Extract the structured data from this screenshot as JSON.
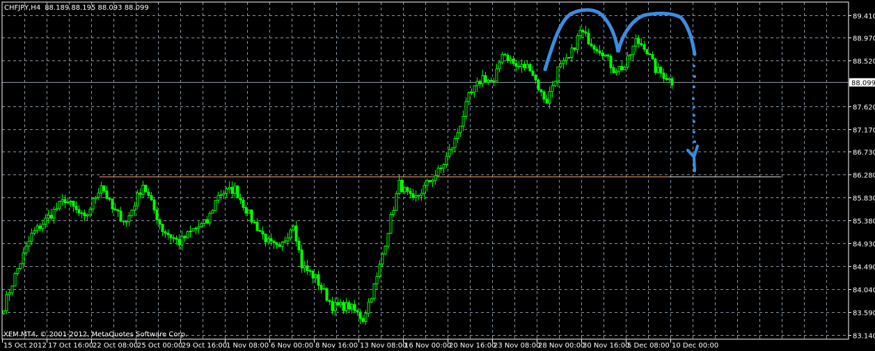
{
  "header": {
    "symbol": "CHFJPY,H4",
    "ohlc": "88.189 88.195 88.093 88.099"
  },
  "footer": {
    "copyright": "XEM MT4, © 2001-2012, MetaQuotes Software Corp."
  },
  "colors": {
    "background": "#000000",
    "candle": "#00ff00",
    "grid": "#8a9aa8",
    "price_line": "#8a9aa8",
    "level_line": "#f0a060",
    "drawing": "#3a8ee0",
    "text": "#ffffff"
  },
  "chart_data": {
    "type": "candlestick",
    "title": "CHFJPY,H4",
    "timeframe": "H4",
    "current_price": "88.099",
    "ylim": [
      83.14,
      89.6
    ],
    "y_ticks": [
      "89.410",
      "88.970",
      "88.520",
      "87.620",
      "87.170",
      "86.730",
      "86.280",
      "85.830",
      "85.380",
      "84.930",
      "84.490",
      "84.040",
      "83.590",
      "83.140"
    ],
    "y_tick_values": [
      89.41,
      88.97,
      88.52,
      87.62,
      87.17,
      86.73,
      86.28,
      85.83,
      85.38,
      84.93,
      84.49,
      84.04,
      83.59,
      83.14
    ],
    "x_ticks": [
      "15 Oct 2012",
      "17 Oct 16:00",
      "22 Oct 08:00",
      "25 Oct 00:00",
      "29 Oct 16:00",
      "1 Nov 08:00",
      "6 Nov 00:00",
      "8 Nov 16:00",
      "13 Nov 08:00",
      "16 Nov 00:00",
      "20 Nov 16:00",
      "23 Nov 08:00",
      "28 Nov 00:00",
      "30 Nov 16:00",
      "5 Dec 08:00",
      "10 Dec 00:00"
    ],
    "bars_per_x_tick": 16,
    "close_waypoints": [
      [
        0,
        83.7
      ],
      [
        4,
        84.3
      ],
      [
        10,
        85.1
      ],
      [
        22,
        85.8
      ],
      [
        29,
        85.4
      ],
      [
        35,
        86.1
      ],
      [
        39,
        85.6
      ],
      [
        44,
        85.35
      ],
      [
        50,
        86.1
      ],
      [
        57,
        85.2
      ],
      [
        63,
        84.95
      ],
      [
        68,
        85.2
      ],
      [
        73,
        85.35
      ],
      [
        77,
        85.9
      ],
      [
        83,
        86.0
      ],
      [
        89,
        85.4
      ],
      [
        95,
        84.95
      ],
      [
        99,
        84.8
      ],
      [
        104,
        85.35
      ],
      [
        107,
        84.5
      ],
      [
        112,
        84.25
      ],
      [
        118,
        83.7
      ],
      [
        124,
        83.7
      ],
      [
        129,
        83.45
      ],
      [
        134,
        84.25
      ],
      [
        138,
        85.2
      ],
      [
        142,
        86.1
      ],
      [
        147,
        85.75
      ],
      [
        152,
        86.1
      ],
      [
        157,
        86.4
      ],
      [
        162,
        86.95
      ],
      [
        167,
        87.8
      ],
      [
        172,
        88.2
      ],
      [
        176,
        88.07
      ],
      [
        179,
        88.7
      ],
      [
        184,
        88.4
      ],
      [
        189,
        88.4
      ],
      [
        193,
        87.87
      ],
      [
        195,
        87.73
      ],
      [
        199,
        88.35
      ],
      [
        203,
        88.55
      ],
      [
        207,
        89.1
      ],
      [
        212,
        88.82
      ],
      [
        215,
        88.7
      ],
      [
        219,
        88.35
      ],
      [
        223,
        88.4
      ],
      [
        227,
        88.9
      ],
      [
        230,
        88.82
      ],
      [
        234,
        88.35
      ],
      [
        238,
        88.2
      ],
      [
        240,
        88.1
      ]
    ],
    "horizontal_level": 86.25,
    "annotation": "hand-drawn double top (M) with dotted arrow pointing down to level"
  }
}
